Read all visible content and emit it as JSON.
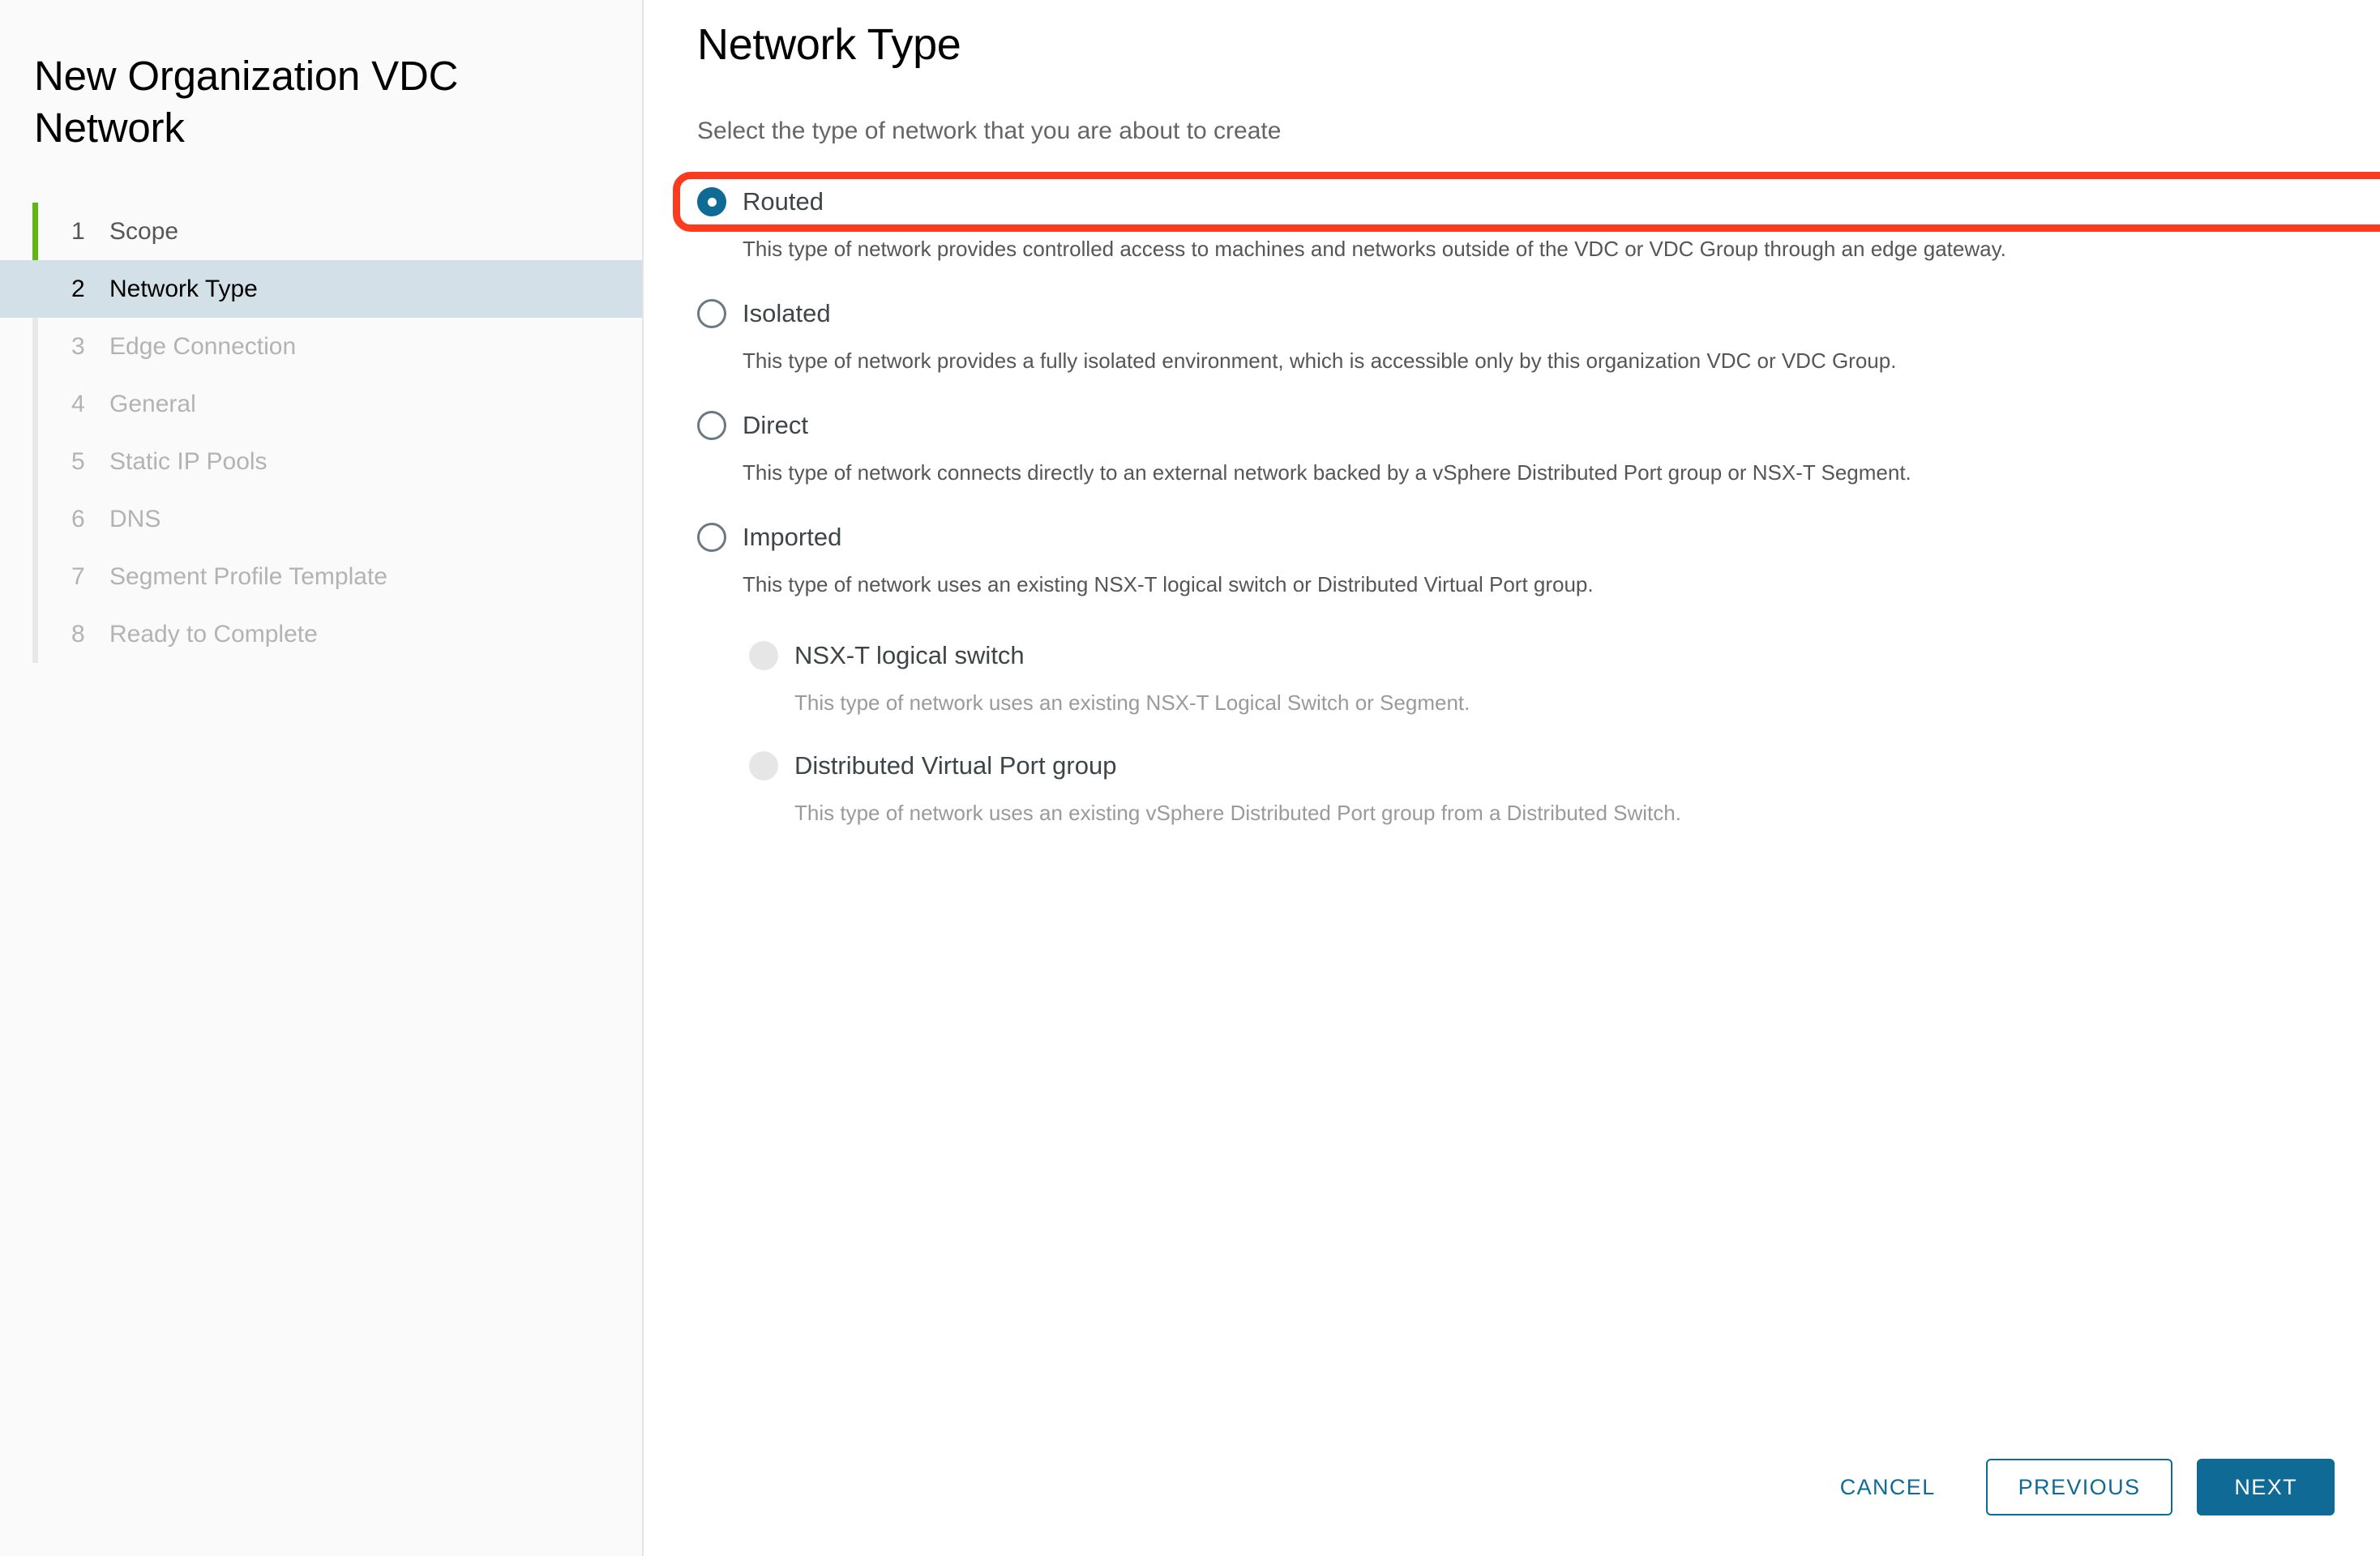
{
  "wizard": {
    "title": "New Organization VDC Network",
    "steps": [
      {
        "num": "1",
        "label": "Scope",
        "state": "done"
      },
      {
        "num": "2",
        "label": "Network Type",
        "state": "current"
      },
      {
        "num": "3",
        "label": "Edge Connection",
        "state": "upcoming"
      },
      {
        "num": "4",
        "label": "General",
        "state": "upcoming"
      },
      {
        "num": "5",
        "label": "Static IP Pools",
        "state": "upcoming"
      },
      {
        "num": "6",
        "label": "DNS",
        "state": "upcoming"
      },
      {
        "num": "7",
        "label": "Segment Profile Template",
        "state": "upcoming"
      },
      {
        "num": "8",
        "label": "Ready to Complete",
        "state": "upcoming"
      }
    ]
  },
  "main": {
    "title": "Network Type",
    "subtitle": "Select the type of network that you are about to create",
    "options": [
      {
        "label": "Routed",
        "description": "This type of network provides controlled access to machines and networks outside of the VDC or VDC Group through an edge gateway.",
        "selected": true
      },
      {
        "label": "Isolated",
        "description": "This type of network provides a fully isolated environment, which is accessible only by this organization VDC or VDC Group.",
        "selected": false
      },
      {
        "label": "Direct",
        "description": "This type of network connects directly to an external network backed by a vSphere Distributed Port group or NSX-T Segment.",
        "selected": false
      },
      {
        "label": "Imported",
        "description": "This type of network uses an existing NSX-T logical switch or Distributed Virtual Port group.",
        "selected": false
      }
    ],
    "sub_options": [
      {
        "label": "NSX-T logical switch",
        "description": "This type of network uses an existing NSX-T Logical Switch or Segment.",
        "disabled": true
      },
      {
        "label": "Distributed Virtual Port group",
        "description": "This type of network uses an existing vSphere Distributed Port group from a Distributed Switch.",
        "disabled": true
      }
    ]
  },
  "footer": {
    "cancel_label": "CANCEL",
    "previous_label": "PREVIOUS",
    "next_label": "NEXT"
  },
  "colors": {
    "accent": "#0f6a96",
    "progress": "#60b515",
    "annotation": "#fb3b1e",
    "current_step_bg": "#d4e0e8"
  }
}
